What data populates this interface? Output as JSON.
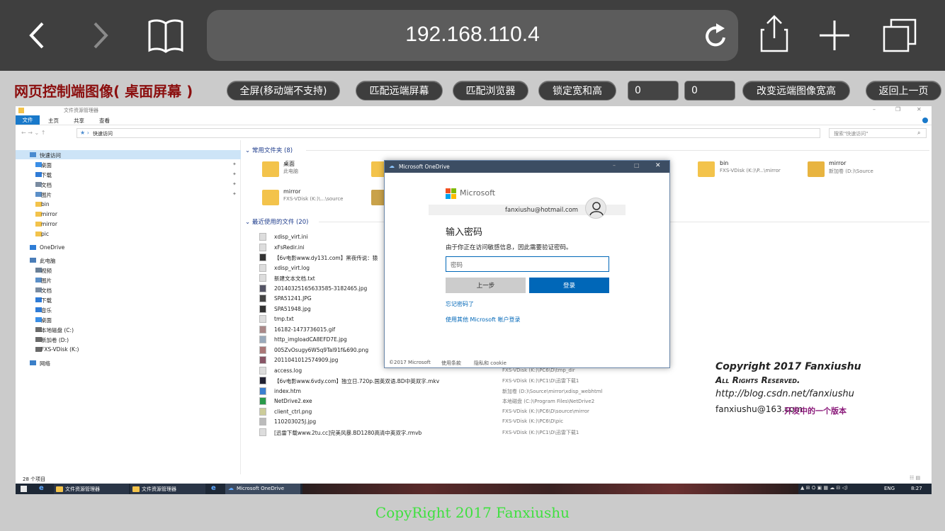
{
  "safari": {
    "url": "192.168.110.4",
    "icons": [
      "back-icon",
      "forward-icon",
      "bookmarks-icon",
      "reload-icon",
      "share-icon",
      "new-tab-icon",
      "tabs-icon"
    ]
  },
  "toolbar": {
    "title": "网页控制端图像( 桌面屏幕 )",
    "buttons": [
      "全屏(移动端不支持)",
      "匹配远端屏幕",
      "匹配浏览器",
      "锁定宽和高",
      "改变远端图像宽高",
      "返回上一页"
    ],
    "width_value": "0",
    "height_value": "0"
  },
  "explorer": {
    "title": "文件资源管理器",
    "ribbon_tabs": [
      "文件",
      "主页",
      "共享",
      "查看"
    ],
    "address": "快速访问",
    "search_placeholder": "搜索\"快速访问\"",
    "nav_items": [
      "快速访问",
      "桌面",
      "下载",
      "文档",
      "图片",
      "bin",
      "mirror",
      "mirror",
      "pic",
      "OneDrive",
      "此电脑",
      "视频",
      "图片",
      "文档",
      "下载",
      "音乐",
      "桌面",
      "本地磁盘 (C:)",
      "新加卷 (D:)",
      "FXS-VDisk (K:)",
      "网络"
    ],
    "frequent_header": "常用文件夹 (8)",
    "frequent": [
      {
        "name": "桌面",
        "sub": "此电脑"
      },
      {
        "name": "bin",
        "sub": "FXS-VDisk (K:)\\P...\\mirror"
      },
      {
        "name": "mirror",
        "sub": "新加卷 (D:)\\Source"
      },
      {
        "name": "mirror",
        "sub": "FXS-VDisk (K:)\\...\\source"
      }
    ],
    "recent_header": "最近使用的文件 (20)",
    "recent": [
      {
        "name": "xdisp_virt.ini",
        "path": ""
      },
      {
        "name": "xFsRedir.ini",
        "path": ""
      },
      {
        "name": "【6v电影www.dy131.com】黑夜传说：猿",
        "path": ""
      },
      {
        "name": "xdisp_virt.log",
        "path": ""
      },
      {
        "name": "新建文本文档.txt",
        "path": ""
      },
      {
        "name": "20140325165633585-3182465.jpg",
        "path": ""
      },
      {
        "name": "SPA51241.JPG",
        "path": ""
      },
      {
        "name": "SPA51948.jpg",
        "path": ""
      },
      {
        "name": "tmp.txt",
        "path": ""
      },
      {
        "name": "16182-1473736015.gif",
        "path": ""
      },
      {
        "name": "http_imgloadCA8EFD7E.jpg",
        "path": ""
      },
      {
        "name": "005ZvOsugy6W5q9Tal91f&690.png",
        "path": ""
      },
      {
        "name": "2011041012574909.jpg",
        "path": ""
      },
      {
        "name": "access.log",
        "path": "FXS-VDisk (K:)\\PC6\\D\\tmp_dir"
      },
      {
        "name": "【6v电影www.6vdy.com】独立日.720p.国英双语.BD中英双字.mkv",
        "path": "FXS-VDisk (K:)\\PC1\\D\\迅雷下载1"
      },
      {
        "name": "index.htm",
        "path": "新加卷 (D:)\\Source\\mirror\\xdisp_webhtml"
      },
      {
        "name": "NetDrive2.exe",
        "path": "本地磁盘 (C:)\\Program Files\\NetDrive2"
      },
      {
        "name": "client_ctrl.png",
        "path": "FXS-VDisk (K:)\\PC6\\D\\source\\mirror"
      },
      {
        "name": "110203025J.jpg",
        "path": "FXS-VDisk (K:)\\PC6\\D\\pic"
      },
      {
        "name": "[迅雷下载www.2tu.cc]完美风暴.BD1280高清中英双字.rmvb",
        "path": "FXS-VDisk (K:)\\PC1\\D\\迅雷下载1"
      }
    ],
    "status": "28 个项目"
  },
  "dialog": {
    "title": "Microsoft OneDrive",
    "brand": "Microsoft",
    "email": "fanxiushu@hotmail.com",
    "heading": "输入密码",
    "desc": "由于你正在访问敏感信息，因此需要验证密码。",
    "password_placeholder": "密码",
    "back_label": "上一步",
    "signin_label": "登录",
    "forgot": "忘记密码了",
    "other": "使用其他 Microsoft 帐户登录",
    "foot_copy": "©2017 Microsoft",
    "foot_terms": "使用条款",
    "foot_privacy": "隐私和 cookie"
  },
  "watermark": {
    "line1": "Copyright 2017 Fanxiushu",
    "line2": "All Rights Reserved.",
    "line3": "http://blog.csdn.net/fanxiushu",
    "line4": "fanxiushu@163.com",
    "line4b": "开发中的一个版本"
  },
  "taskbar": {
    "items": [
      "文件资源管理器",
      "文件资源管理器",
      "Microsoft OneDrive"
    ],
    "lang": "ENG",
    "time": "8:27"
  },
  "footer": "CopyRight 2017 Fanxiushu",
  "colors": {
    "accent": "#0063b1",
    "title_red": "#8b0f0f",
    "footer_green": "#3fe03f"
  }
}
